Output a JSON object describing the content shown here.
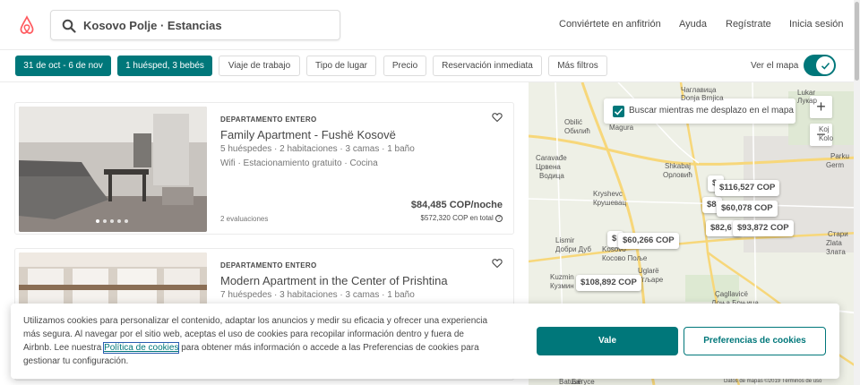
{
  "header": {
    "search_text": "Kosovo Polje · Estancias",
    "nav": [
      "Conviértete en anfitrión",
      "Ayuda",
      "Regístrate",
      "Inicia sesión"
    ]
  },
  "filters": {
    "dates": "31 de oct - 6 de nov",
    "guests": "1 huésped, 3 bebés",
    "chips": [
      "Viaje de trabajo",
      "Tipo de lugar",
      "Precio",
      "Reservación inmediata",
      "Más filtros"
    ],
    "map_toggle_label": "Ver el mapa",
    "map_toggle_on": true
  },
  "listings": [
    {
      "type": "DEPARTAMENTO ENTERO",
      "title": "Family Apartment - Fushë Kosovë",
      "details": "5 huéspedes · 2 habitaciones · 3 camas · 1 baño",
      "amenities": "Wifi · Estacionamiento gratuito · Cocina",
      "reviews": "2 evaluaciones",
      "price": "$84,485 COP/noche",
      "total": "$572,320 COP en total"
    },
    {
      "type": "DEPARTAMENTO ENTERO",
      "title": "Modern Apartment in the Center of Prishtina",
      "details": "7 huéspedes · 3 habitaciones · 3 camas · 1 baño"
    }
  ],
  "map": {
    "checkbox_label": "Buscar mientras me desplazo en el mapa",
    "checkbox_checked": true,
    "zoom_in": "+",
    "zoom_out": "−",
    "pins": [
      "$116,527 COP",
      "$60,078 COP",
      "$93,872 COP",
      "$60,266 COP",
      "$108,892 COP",
      "$82,6",
      "$8",
      "$",
      "$"
    ],
    "places": [
      "Lukar",
      "Лукар",
      "Koj",
      "Kolo",
      "Parku",
      "Germ",
      "Стари",
      "Zlata",
      "Злата",
      "Caravađe",
      "Црвена",
      "Водица",
      "Kryshevc",
      "Крушевац",
      "Obilić",
      "Обилић",
      "Magura",
      "Shkabaj",
      "Орловић",
      "Lismir",
      "Добри Дуб",
      "Kosovo",
      "Косово Поље",
      "Kuzmin",
      "Кузмин",
      "Uglarë",
      "Угљаре",
      "Çagllavicë",
      "Чаглавица",
      "Donja Brnjica",
      "Доња Брњица",
      "Batusë",
      "Батусе"
    ],
    "attribution": "Datos de mapas ©2019   Términos de uso"
  },
  "cookie": {
    "text_before": "Utilizamos cookies para personalizar el contenido, adaptar los anuncios y medir su eficacia y ofrecer una experiencia más segura. Al navegar por el sitio web, aceptas el uso de cookies para recopilar información dentro y fuera de Airbnb. Lee nuestra ",
    "link": "Política de cookies",
    "text_after": " para obtener más información o accede a las Preferencias de cookies para gestionar tu configuración.",
    "accept": "Vale",
    "preferences": "Preferencias de cookies"
  },
  "colors": {
    "brand": "#ff5a5f",
    "accent": "#00777a"
  }
}
